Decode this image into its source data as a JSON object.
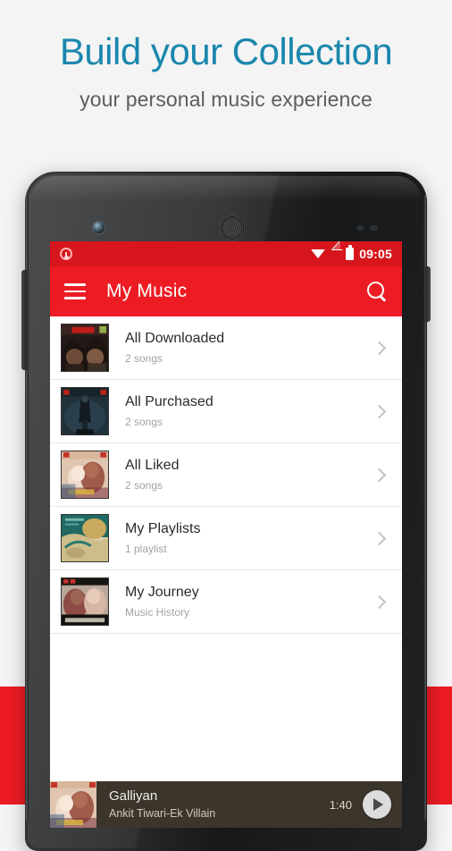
{
  "promo": {
    "headline": "Build your Collection",
    "subhead": "your personal music experience",
    "headline_color": "#1b87ad",
    "band_color": "#ed1c24"
  },
  "statusbar": {
    "notification_icon": "music-note-icon",
    "wifi_icon": "wifi-icon",
    "signal_icon": "signal-icon",
    "battery_icon": "battery-icon",
    "time": "09:05"
  },
  "appbar": {
    "menu_icon": "hamburger-menu-icon",
    "title": "My Music",
    "search_icon": "search-icon",
    "bg_color": "#ed1c24"
  },
  "list": {
    "items": [
      {
        "title": "All Downloaded",
        "subtitle": "2 songs",
        "art": "shaanti-poster"
      },
      {
        "title": "All Purchased",
        "subtitle": "2 songs",
        "art": "dark-thriller-poster"
      },
      {
        "title": "All Liked",
        "subtitle": "2 songs",
        "art": "ek-villain-poster"
      },
      {
        "title": "My Playlists",
        "subtitle": "1 playlist",
        "art": "vintage-teal-art"
      },
      {
        "title": "My Journey",
        "subtitle": "Music History",
        "art": "khamoshiyan-poster"
      }
    ]
  },
  "player": {
    "title": "Galliyan",
    "artist": "Ankit Tiwari-Ek Villain",
    "time": "1:40",
    "play_icon": "play-icon",
    "bg_color": "#3b352c"
  }
}
